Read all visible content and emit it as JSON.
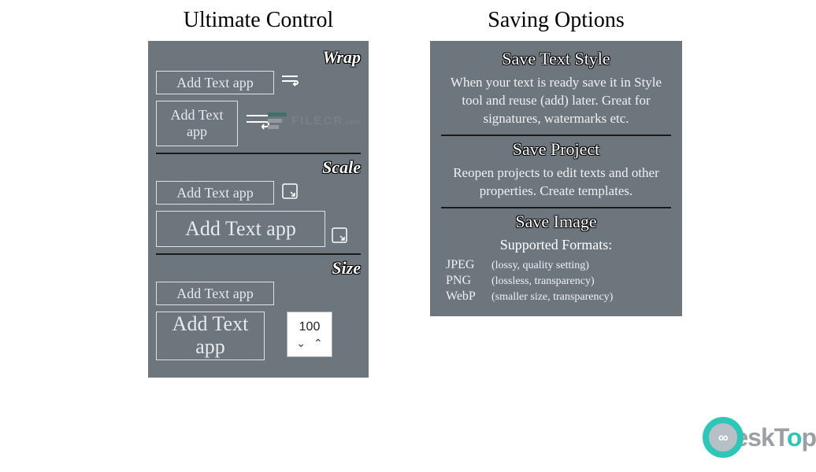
{
  "left": {
    "title": "Ultimate Control",
    "wrap": {
      "label": "Wrap",
      "box1": "Add Text app",
      "box2": "Add Text app"
    },
    "scale": {
      "label": "Scale",
      "box1": "Add Text app",
      "box2": "Add Text app"
    },
    "size": {
      "label": "Size",
      "box1": "Add Text app",
      "box2": "Add Text app",
      "spinner_value": "100"
    }
  },
  "right": {
    "title": "Saving Options",
    "style": {
      "header": "Save Text Style",
      "desc": "When your text is ready save it in Style tool and reuse (add) later. Great for signatures, watermarks etc."
    },
    "project": {
      "header": "Save Project",
      "desc": "Reopen projects to edit texts and other properties. Create templates."
    },
    "image": {
      "header": "Save Image",
      "sub": "Supported Formats:",
      "formats": {
        "0": {
          "name": "JPEG",
          "note": "(lossy, quality setting)"
        },
        "1": {
          "name": "PNG",
          "note": "(lossless, transparency)"
        },
        "2": {
          "name": "WebP",
          "note": "(smaller size, transparency)"
        }
      }
    }
  },
  "watermarks": {
    "filecr": "FILECR",
    "filecr_sub": ".com",
    "desktop_pre": "eskT",
    "desktop_accent": "o",
    "desktop_post": "p",
    "ring": "∞"
  }
}
